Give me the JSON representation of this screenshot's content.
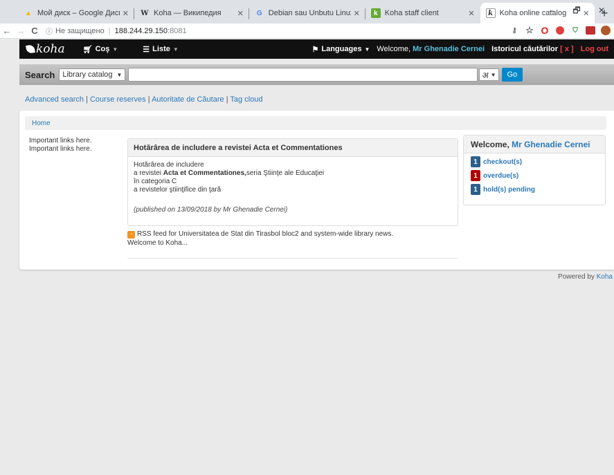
{
  "browser": {
    "tabs": [
      {
        "label": "Мой диск – Google Диск",
        "icon": "G",
        "icon_color": "#f4b400",
        "active": false
      },
      {
        "label": "Koha — Википедия",
        "icon": "W",
        "icon_color": "#333333",
        "active": false
      },
      {
        "label": "Debian sau Unbutu Linux - ",
        "icon": "G",
        "icon_color": "#4285f4",
        "active": false
      },
      {
        "label": "Koha staff client",
        "icon": "k",
        "icon_color": "#66aa33",
        "active": false
      },
      {
        "label": "Koha online catalog",
        "icon": "k",
        "icon_color": "#66aa33",
        "active": true
      }
    ],
    "new_tab": "+",
    "window_controls": [
      "–",
      "🗗",
      "✕"
    ],
    "address": {
      "insecure_label": "Не защищено",
      "host": "188.244.29.150",
      "port": ":8081"
    },
    "nav": {
      "back": "←",
      "forward": "→",
      "reload": "C",
      "info": "ⓘ"
    }
  },
  "navbar": {
    "logo": "koha",
    "cart": "Coş",
    "lists": "Liste",
    "languages": "Languages",
    "welcome": "Welcome,",
    "user_name": "Mr Ghenadie Cernei",
    "history": "Istoricul căutărilor",
    "history_clear": "[ x ]",
    "logout": "Log out"
  },
  "search": {
    "label": "Search",
    "scope": "Library catalog",
    "keyboard": "अ",
    "go": "Go"
  },
  "more_searches": {
    "advanced": "Advanced search",
    "course": "Course reserves",
    "authority": "Autoritate de Căutare",
    "tag_cloud": "Tag cloud",
    "separator": "|"
  },
  "breadcrumb": {
    "home": "Home"
  },
  "sidebar": {
    "lines": [
      "Important links here.",
      "Important links here."
    ]
  },
  "news": {
    "title": "Hotărârea de includere a revistei Acta et Commentationes",
    "line1": "Hotărârea de includere",
    "line2_prefix": "a revistei ",
    "line2_bold": "Acta et Commentationes,",
    "line2_suffix": "seria Ştiinţe ale Educaţiei",
    "line3": "în categoria C",
    "line4": "a revistelor ştiinţifice din ţară",
    "published": "(published on 13/09/2018 by Mr Ghenadie Cernei)"
  },
  "rss": {
    "text": "RSS feed for Universitatea de Stat din Tirasbol bloc2 and system-wide library news."
  },
  "welcome_text": "Welcome to Koha...",
  "user_summary": {
    "welcome": "Welcome, ",
    "name": "Mr Ghenadie Cernei",
    "items": [
      {
        "count": "1",
        "label": "checkout(s)",
        "color": "#2c5f8a"
      },
      {
        "count": "1",
        "label": "overdue(s)",
        "color": "#b00000"
      },
      {
        "count": "1",
        "label": "hold(s) pending",
        "color": "#2c5f8a"
      }
    ]
  },
  "footer": {
    "powered": "Powered by ",
    "link": "Koha"
  }
}
